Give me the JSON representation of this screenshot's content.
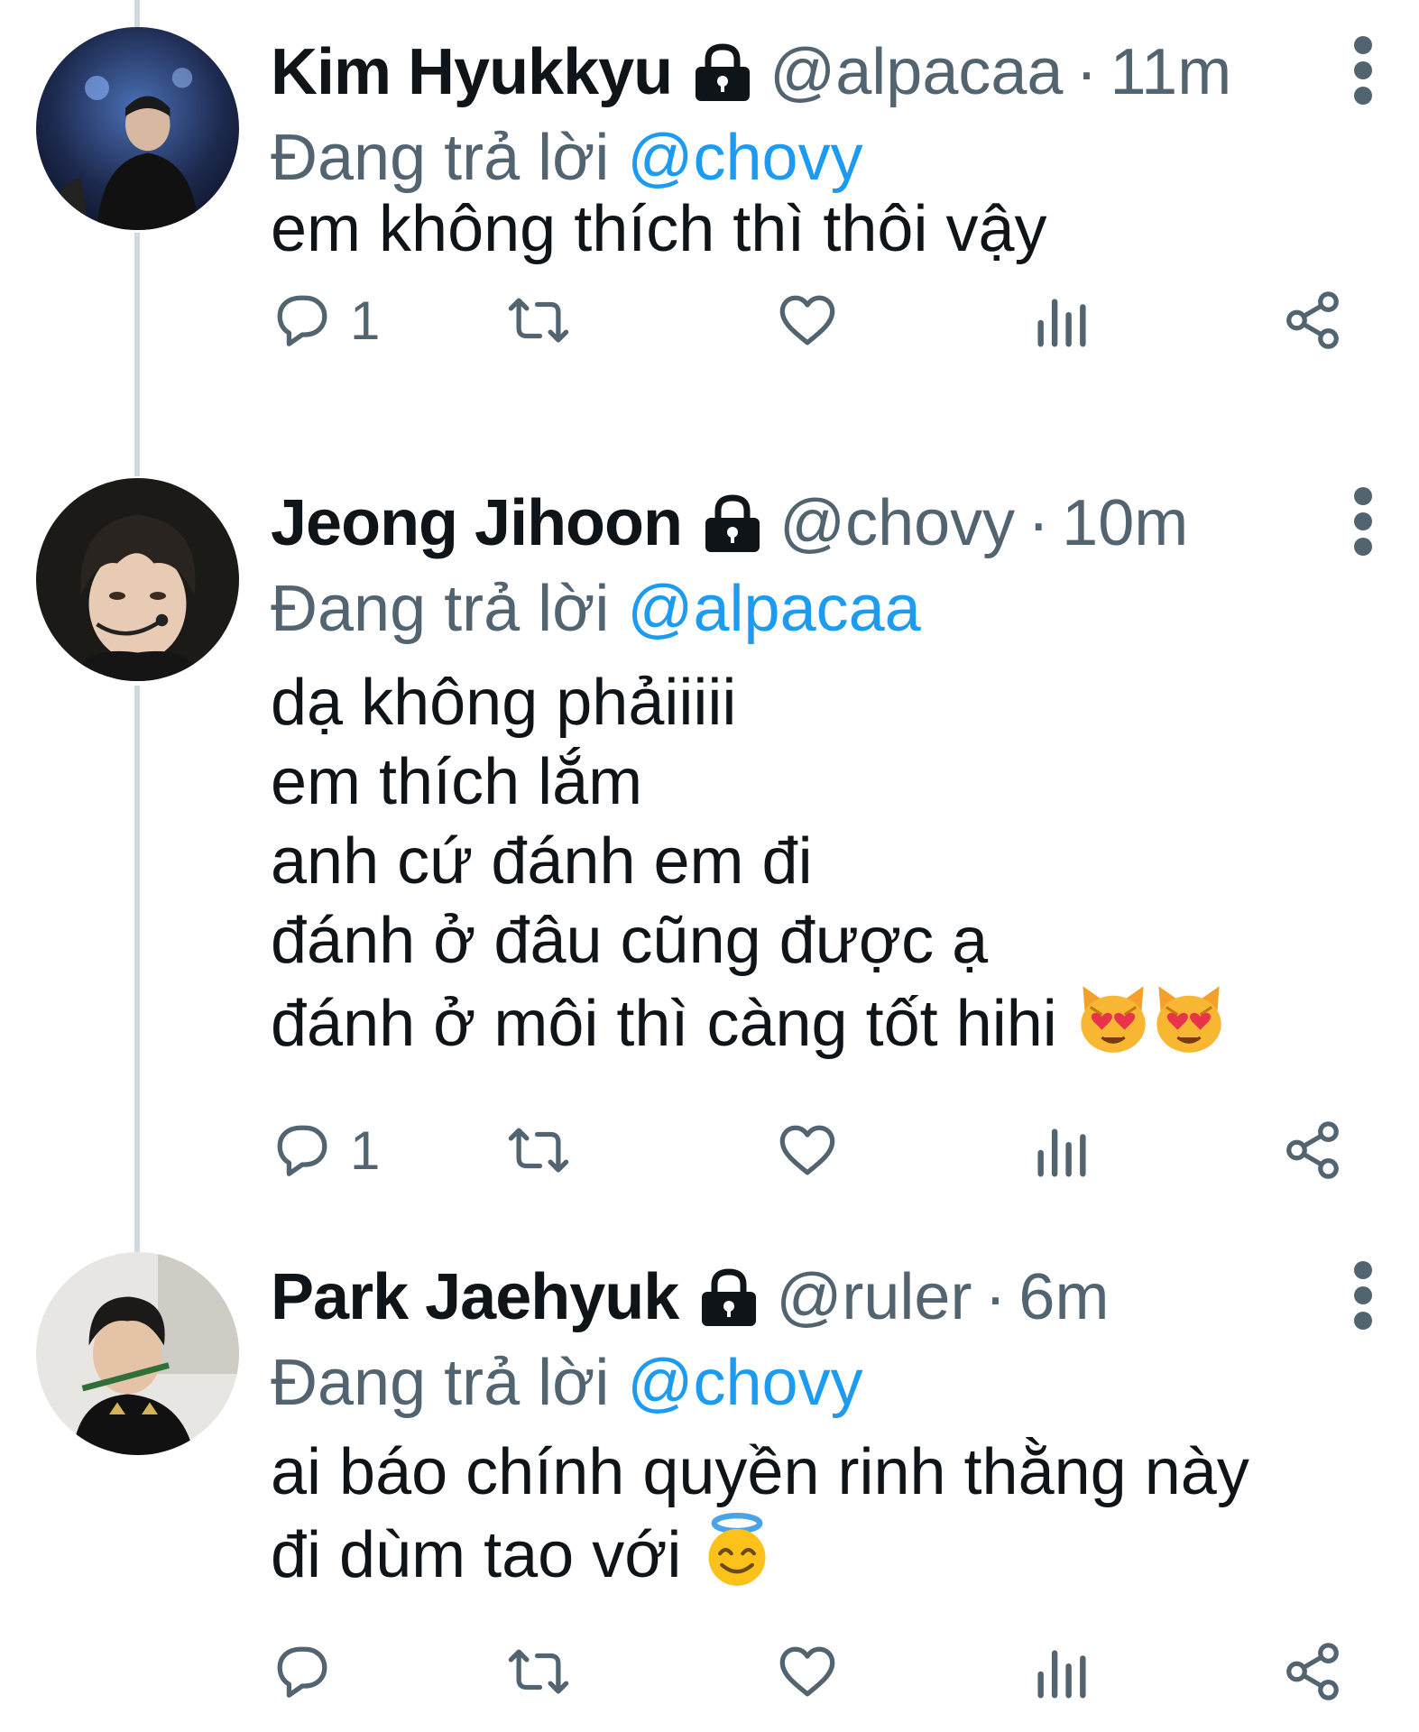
{
  "reply_prefix": "Đang trả lời",
  "colors": {
    "accent": "#1d9bf0",
    "secondary_text": "#536471",
    "primary_text": "#0f1419",
    "thread_line": "#cfd9de"
  },
  "tweets": [
    {
      "name": "Kim Hyukkyu",
      "locked": true,
      "handle": "@alpacaa",
      "separator": "·",
      "time": "11m",
      "reply_to": "@chovy",
      "body_lines": [
        "em không thích thì thôi vậy"
      ],
      "reply_count": "1",
      "avatar_icon": "avatar-photo"
    },
    {
      "name": "Jeong Jihoon",
      "locked": true,
      "handle": "@chovy",
      "separator": "·",
      "time": "10m",
      "reply_to": "@alpacaa",
      "body_lines": [
        "dạ không phảiiiii",
        "em thích lắm",
        "anh cứ đánh em đi",
        "đánh ở đâu cũng được ạ",
        "đánh ở môi thì càng tốt hihi"
      ],
      "emoji": [
        "heart-eyes-cat-emoji",
        "heart-eyes-cat-emoji"
      ],
      "reply_count": "1",
      "avatar_icon": "avatar-photo"
    },
    {
      "name": "Park Jaehyuk",
      "locked": true,
      "handle": "@ruler",
      "separator": "·",
      "time": "6m",
      "reply_to": "@chovy",
      "body_lines": [
        "ai báo chính quyền rinh thằng này",
        "đi dùm tao với"
      ],
      "emoji": [
        "halo-smile-emoji"
      ],
      "reply_count": "",
      "avatar_icon": "avatar-photo"
    }
  ],
  "action_icons": [
    "reply-icon",
    "retweet-icon",
    "like-icon",
    "views-icon",
    "share-icon"
  ]
}
